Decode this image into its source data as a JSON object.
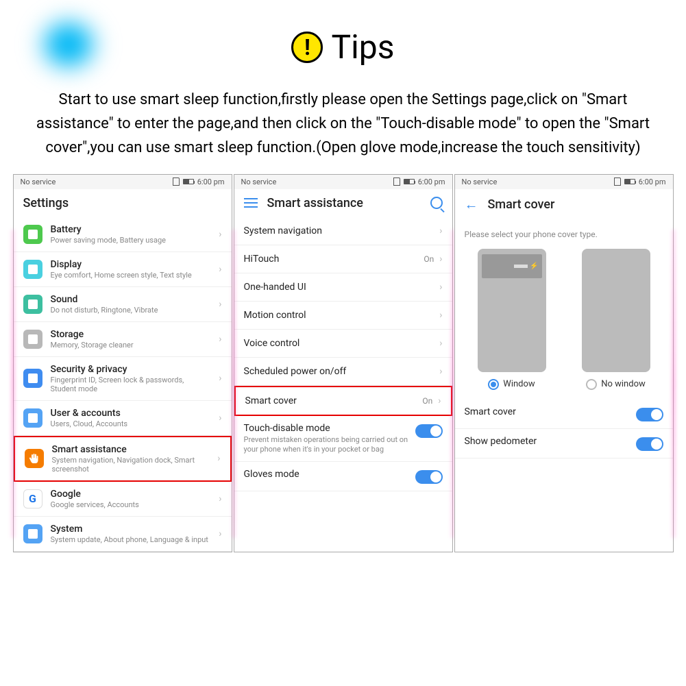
{
  "header": {
    "title": "Tips"
  },
  "instruction": "Start to use smart sleep function,firstly please open the Settings page,click on \"Smart assistance\" to enter the page,and then click on the \"Touch-disable mode\" to open the \"Smart cover\",you can use smart sleep function.(Open glove mode,increase the touch sensitivity)",
  "status": {
    "service": "No service",
    "time": "6:00 pm"
  },
  "phone1": {
    "title": "Settings",
    "items": [
      {
        "title": "Battery",
        "sub": "Power saving mode, Battery usage"
      },
      {
        "title": "Display",
        "sub": "Eye comfort, Home screen style, Text style"
      },
      {
        "title": "Sound",
        "sub": "Do not disturb, Ringtone, Vibrate"
      },
      {
        "title": "Storage",
        "sub": "Memory, Storage cleaner"
      },
      {
        "title": "Security & privacy",
        "sub": "Fingerprint ID, Screen lock & passwords, Student mode"
      },
      {
        "title": "User & accounts",
        "sub": "Users, Cloud, Accounts"
      },
      {
        "title": "Smart assistance",
        "sub": "System navigation, Navigation dock, Smart screenshot"
      },
      {
        "title": "Google",
        "sub": "Google services, Accounts"
      },
      {
        "title": "System",
        "sub": "System update, About phone, Language & input"
      }
    ]
  },
  "phone2": {
    "title": "Smart assistance",
    "items": {
      "sysnav": "System navigation",
      "hitouch": "HiTouch",
      "hitouch_val": "On",
      "onehand": "One-handed UI",
      "motion": "Motion control",
      "voice": "Voice control",
      "sched": "Scheduled power on/off",
      "smartcover": "Smart cover",
      "smartcover_val": "On",
      "touchdisable": "Touch-disable mode",
      "touchdisable_sub": "Prevent mistaken operations being carried out on your phone when it's in your pocket or bag",
      "gloves": "Gloves mode"
    }
  },
  "phone3": {
    "title": "Smart cover",
    "prompt": "Please select your phone cover type.",
    "opt_window": "Window",
    "opt_nowindow": "No window",
    "smartcover": "Smart cover",
    "pedometer": "Show pedometer"
  }
}
